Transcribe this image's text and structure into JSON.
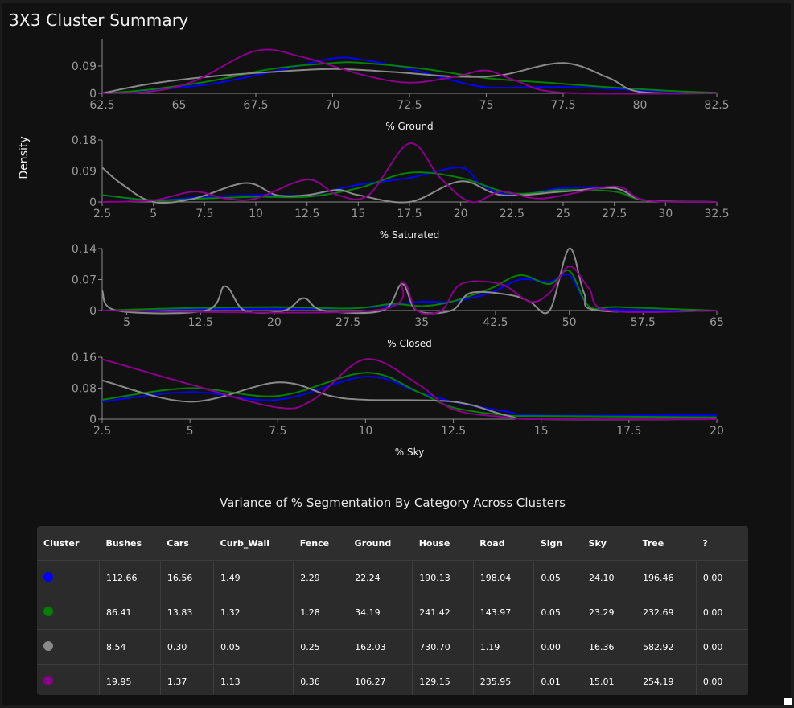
{
  "page": {
    "title": "3X3 Cluster Summary"
  },
  "colors": {
    "c1": "#0000ff",
    "c2": "#008000",
    "c3": "#8a8a8a",
    "c4": "#8b008b"
  },
  "chart_data": [
    {
      "type": "line",
      "ylabel": "Density",
      "xlabel": "% Ground",
      "xlim": [
        62.5,
        82.5
      ],
      "ylim": [
        0,
        0.18
      ],
      "xticks": [
        "62.5",
        "65",
        "67.5",
        "70",
        "72.5",
        "75",
        "77.5",
        "80",
        "82.5"
      ],
      "yticks": [
        "0",
        "0.09"
      ],
      "series": [
        {
          "color": "#0000ff",
          "points": [
            [
              62.5,
              0
            ],
            [
              64,
              0.01
            ],
            [
              66,
              0.03
            ],
            [
              68,
              0.07
            ],
            [
              70,
              0.115
            ],
            [
              71,
              0.11
            ],
            [
              72.5,
              0.08
            ],
            [
              74,
              0.04
            ],
            [
              75,
              0.02
            ],
            [
              76.5,
              0.02
            ],
            [
              78,
              0.02
            ],
            [
              80,
              0.01
            ],
            [
              82.5,
              0.002
            ]
          ]
        },
        {
          "color": "#008000",
          "points": [
            [
              62.5,
              0
            ],
            [
              64,
              0.012
            ],
            [
              66,
              0.04
            ],
            [
              68,
              0.08
            ],
            [
              70,
              0.1
            ],
            [
              71,
              0.1
            ],
            [
              73,
              0.08
            ],
            [
              75,
              0.05
            ],
            [
              77,
              0.035
            ],
            [
              79,
              0.02
            ],
            [
              81,
              0.008
            ],
            [
              82.5,
              0.002
            ]
          ]
        },
        {
          "color": "#8a8a8a",
          "points": [
            [
              62.5,
              0
            ],
            [
              64,
              0.03
            ],
            [
              66,
              0.055
            ],
            [
              68,
              0.07
            ],
            [
              70,
              0.08
            ],
            [
              72,
              0.07
            ],
            [
              74,
              0.055
            ],
            [
              75.5,
              0.06
            ],
            [
              77.5,
              0.1
            ],
            [
              79,
              0.05
            ],
            [
              80,
              0.005
            ],
            [
              82.5,
              0
            ]
          ]
        },
        {
          "color": "#8b008b",
          "points": [
            [
              62.5,
              0
            ],
            [
              64,
              0.005
            ],
            [
              65.5,
              0.04
            ],
            [
              67.5,
              0.14
            ],
            [
              69,
              0.12
            ],
            [
              71,
              0.06
            ],
            [
              72.5,
              0.035
            ],
            [
              74,
              0.055
            ],
            [
              75,
              0.075
            ],
            [
              76,
              0.04
            ],
            [
              77.5,
              0.002
            ],
            [
              82.5,
              0
            ]
          ]
        }
      ]
    },
    {
      "type": "line",
      "xlabel": "% Saturated",
      "xlim": [
        2.5,
        32.5
      ],
      "ylim": [
        0,
        0.18
      ],
      "xticks": [
        "2.5",
        "5",
        "7.5",
        "10",
        "12.5",
        "15",
        "17.5",
        "20",
        "22.5",
        "25",
        "27.5",
        "30",
        "32.5"
      ],
      "yticks": [
        "0",
        "0.09",
        "0.18"
      ],
      "series": [
        {
          "color": "#0000ff",
          "points": [
            [
              2.5,
              0.02
            ],
            [
              5,
              0.005
            ],
            [
              7.5,
              0.015
            ],
            [
              10,
              0.02
            ],
            [
              12.5,
              0.02
            ],
            [
              15,
              0.05
            ],
            [
              17.5,
              0.07
            ],
            [
              20,
              0.1
            ],
            [
              21,
              0.05
            ],
            [
              22.5,
              0.02
            ],
            [
              25,
              0.04
            ],
            [
              27.5,
              0.04
            ],
            [
              29,
              0.005
            ],
            [
              32.5,
              0
            ]
          ]
        },
        {
          "color": "#008000",
          "points": [
            [
              2.5,
              0.02
            ],
            [
              5,
              0.005
            ],
            [
              7.5,
              0.01
            ],
            [
              10,
              0.015
            ],
            [
              12.5,
              0.015
            ],
            [
              15,
              0.04
            ],
            [
              17.5,
              0.085
            ],
            [
              20,
              0.07
            ],
            [
              22.5,
              0.025
            ],
            [
              25,
              0.035
            ],
            [
              27.5,
              0.03
            ],
            [
              29,
              0.005
            ],
            [
              32.5,
              0
            ]
          ]
        },
        {
          "color": "#8a8a8a",
          "points": [
            [
              2.5,
              0.1
            ],
            [
              3.5,
              0.05
            ],
            [
              5,
              0
            ],
            [
              7,
              0.01
            ],
            [
              9.5,
              0.055
            ],
            [
              11,
              0.02
            ],
            [
              12.5,
              0.02
            ],
            [
              14,
              0.035
            ],
            [
              15,
              0.02
            ],
            [
              17.5,
              0
            ],
            [
              20,
              0.06
            ],
            [
              22,
              0.02
            ],
            [
              25,
              0.03
            ],
            [
              27.5,
              0.04
            ],
            [
              29,
              0.005
            ],
            [
              32.5,
              0
            ]
          ]
        },
        {
          "color": "#8b008b",
          "points": [
            [
              2.5,
              0
            ],
            [
              5,
              0.005
            ],
            [
              7,
              0.03
            ],
            [
              8.5,
              0.01
            ],
            [
              10,
              0.01
            ],
            [
              12.5,
              0.065
            ],
            [
              14,
              0.02
            ],
            [
              15.5,
              0.02
            ],
            [
              17.5,
              0.17
            ],
            [
              19,
              0.07
            ],
            [
              20.5,
              0
            ],
            [
              22,
              0.03
            ],
            [
              24,
              0.01
            ],
            [
              27.5,
              0.045
            ],
            [
              29,
              0.005
            ],
            [
              32.5,
              0
            ]
          ]
        }
      ]
    },
    {
      "type": "line",
      "xlabel": "% Closed",
      "xlim": [
        2.5,
        65
      ],
      "ylim": [
        0,
        0.14
      ],
      "xticks": [
        "5",
        "12.5",
        "20",
        "27.5",
        "35",
        "42.5",
        "50",
        "57.5",
        "65"
      ],
      "yticks": [
        "0",
        "0.07",
        "0.14"
      ],
      "series": [
        {
          "color": "#0000ff",
          "points": [
            [
              2.5,
              0
            ],
            [
              10,
              0.003
            ],
            [
              20,
              0.004
            ],
            [
              28,
              0.005
            ],
            [
              32,
              0.012
            ],
            [
              35,
              0.02
            ],
            [
              38,
              0.02
            ],
            [
              42,
              0.04
            ],
            [
              45,
              0.07
            ],
            [
              48,
              0.065
            ],
            [
              50,
              0.08
            ],
            [
              52,
              0.01
            ],
            [
              55,
              0.002
            ],
            [
              65,
              0
            ]
          ]
        },
        {
          "color": "#008000",
          "points": [
            [
              2.5,
              0
            ],
            [
              10,
              0.005
            ],
            [
              20,
              0.008
            ],
            [
              28,
              0.005
            ],
            [
              32,
              0.015
            ],
            [
              35,
              0.01
            ],
            [
              38,
              0.02
            ],
            [
              42,
              0.05
            ],
            [
              45,
              0.08
            ],
            [
              48,
              0.06
            ],
            [
              50,
              0.09
            ],
            [
              52,
              0.01
            ],
            [
              55,
              0.008
            ],
            [
              65,
              0
            ]
          ]
        },
        {
          "color": "#8a8a8a",
          "points": [
            [
              2.5,
              0.045
            ],
            [
              4,
              0
            ],
            [
              13,
              0
            ],
            [
              15,
              0.055
            ],
            [
              17,
              0
            ],
            [
              21,
              0
            ],
            [
              23,
              0.028
            ],
            [
              25,
              0
            ],
            [
              31,
              0
            ],
            [
              33,
              0.06
            ],
            [
              34.5,
              0
            ],
            [
              38,
              0
            ],
            [
              40,
              0.04
            ],
            [
              44,
              0.035
            ],
            [
              46,
              0.02
            ],
            [
              48,
              0
            ],
            [
              50,
              0.14
            ],
            [
              51.5,
              0.04
            ],
            [
              53,
              0
            ],
            [
              65,
              0
            ]
          ]
        },
        {
          "color": "#8b008b",
          "points": [
            [
              2.5,
              0
            ],
            [
              30,
              0
            ],
            [
              33,
              0.065
            ],
            [
              34.5,
              0
            ],
            [
              37,
              0
            ],
            [
              39,
              0.06
            ],
            [
              43,
              0.06
            ],
            [
              46,
              0.02
            ],
            [
              48,
              0.04
            ],
            [
              50,
              0.1
            ],
            [
              52,
              0.05
            ],
            [
              54,
              0
            ],
            [
              65,
              0
            ]
          ]
        }
      ]
    },
    {
      "type": "line",
      "xlabel": "% Sky",
      "xlim": [
        2.5,
        20
      ],
      "ylim": [
        0,
        0.16
      ],
      "xticks": [
        "2.5",
        "5",
        "7.5",
        "10",
        "12.5",
        "15",
        "17.5",
        "20"
      ],
      "yticks": [
        "0",
        "0.08",
        "0.16"
      ],
      "series": [
        {
          "color": "#0000ff",
          "points": [
            [
              2.5,
              0.045
            ],
            [
              5,
              0.07
            ],
            [
              7.5,
              0.05
            ],
            [
              10,
              0.11
            ],
            [
              11.5,
              0.07
            ],
            [
              12.5,
              0.045
            ],
            [
              14,
              0.02
            ],
            [
              15,
              0.01
            ],
            [
              20,
              0.01
            ]
          ]
        },
        {
          "color": "#008000",
          "points": [
            [
              2.5,
              0.05
            ],
            [
              5,
              0.08
            ],
            [
              7.5,
              0.06
            ],
            [
              10,
              0.12
            ],
            [
              11.5,
              0.07
            ],
            [
              12.5,
              0.03
            ],
            [
              14,
              0.01
            ],
            [
              15,
              0.008
            ],
            [
              20,
              0.005
            ]
          ]
        },
        {
          "color": "#8a8a8a",
          "points": [
            [
              2.5,
              0.1
            ],
            [
              5,
              0.045
            ],
            [
              7.5,
              0.095
            ],
            [
              9,
              0.06
            ],
            [
              10,
              0.05
            ],
            [
              12.5,
              0.045
            ],
            [
              14,
              0.01
            ],
            [
              15,
              0
            ],
            [
              20,
              0
            ]
          ]
        },
        {
          "color": "#8b008b",
          "points": [
            [
              2.5,
              0.155
            ],
            [
              5,
              0.09
            ],
            [
              7.5,
              0.03
            ],
            [
              8.5,
              0.05
            ],
            [
              10,
              0.155
            ],
            [
              11.5,
              0.09
            ],
            [
              12.5,
              0.025
            ],
            [
              14,
              0.005
            ],
            [
              15,
              0
            ],
            [
              20,
              0
            ]
          ]
        }
      ]
    }
  ],
  "table": {
    "title": "Variance of % Segmentation By Category Across Clusters",
    "headers": [
      "Cluster",
      "Bushes",
      "Cars",
      "Curb_Wall",
      "Fence",
      "Ground",
      "House",
      "Road",
      "Sign",
      "Sky",
      "Tree",
      "?"
    ],
    "rows": [
      {
        "color": "#0000ff",
        "values": [
          "112.66",
          "16.56",
          "1.49",
          "2.29",
          "22.24",
          "190.13",
          "198.04",
          "0.05",
          "24.10",
          "196.46",
          "0.00"
        ]
      },
      {
        "color": "#008000",
        "values": [
          "86.41",
          "13.83",
          "1.32",
          "1.28",
          "34.19",
          "241.42",
          "143.97",
          "0.05",
          "23.29",
          "232.69",
          "0.00"
        ]
      },
      {
        "color": "#8a8a8a",
        "values": [
          "8.54",
          "0.30",
          "0.05",
          "0.25",
          "162.03",
          "730.70",
          "1.19",
          "0.00",
          "16.36",
          "582.92",
          "0.00"
        ]
      },
      {
        "color": "#8b008b",
        "values": [
          "19.95",
          "1.37",
          "1.13",
          "0.36",
          "106.27",
          "129.15",
          "235.95",
          "0.01",
          "15.01",
          "254.19",
          "0.00"
        ]
      }
    ]
  }
}
